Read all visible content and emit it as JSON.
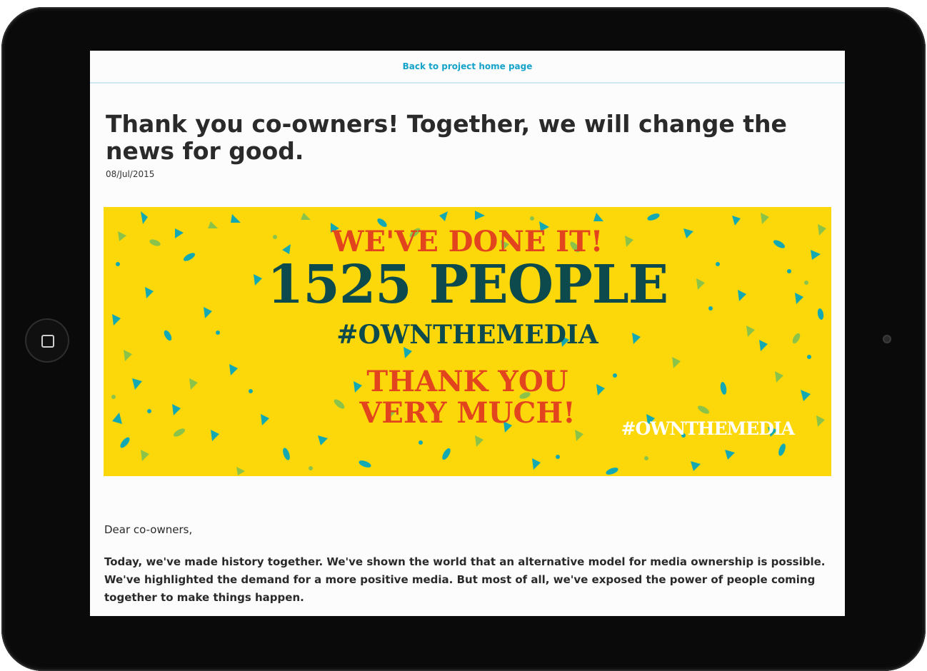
{
  "nav": {
    "back_label": "Back to project home page"
  },
  "post": {
    "title": "Thank you co-owners! Together, we will change the news for good.",
    "date": "08/Jul/2015"
  },
  "banner": {
    "line1": "WE'VE DONE IT!",
    "line2": "1525 PEOPLE",
    "line3": "#OWNTHEMEDIA",
    "line4a": "THANK YOU",
    "line4b": "VERY MUCH!",
    "tag": "#OWNTHEMEDIA",
    "colors": {
      "background": "#fcd80b",
      "orange": "#e2441d",
      "teal": "#0d4a4d",
      "confetti_a": "#13a9b3",
      "confetti_b": "#8bc34a"
    }
  },
  "body": {
    "greeting": "Dear co-owners,",
    "paragraph": "Today, we've made history together. We've shown the world that an alternative model for media ownership is possible. We've highlighted the demand for a more positive media. But most of all, we've exposed the power of people coming together to make things happen."
  },
  "device": {
    "home_icon": "home-button-icon",
    "camera_icon": "camera-icon"
  }
}
